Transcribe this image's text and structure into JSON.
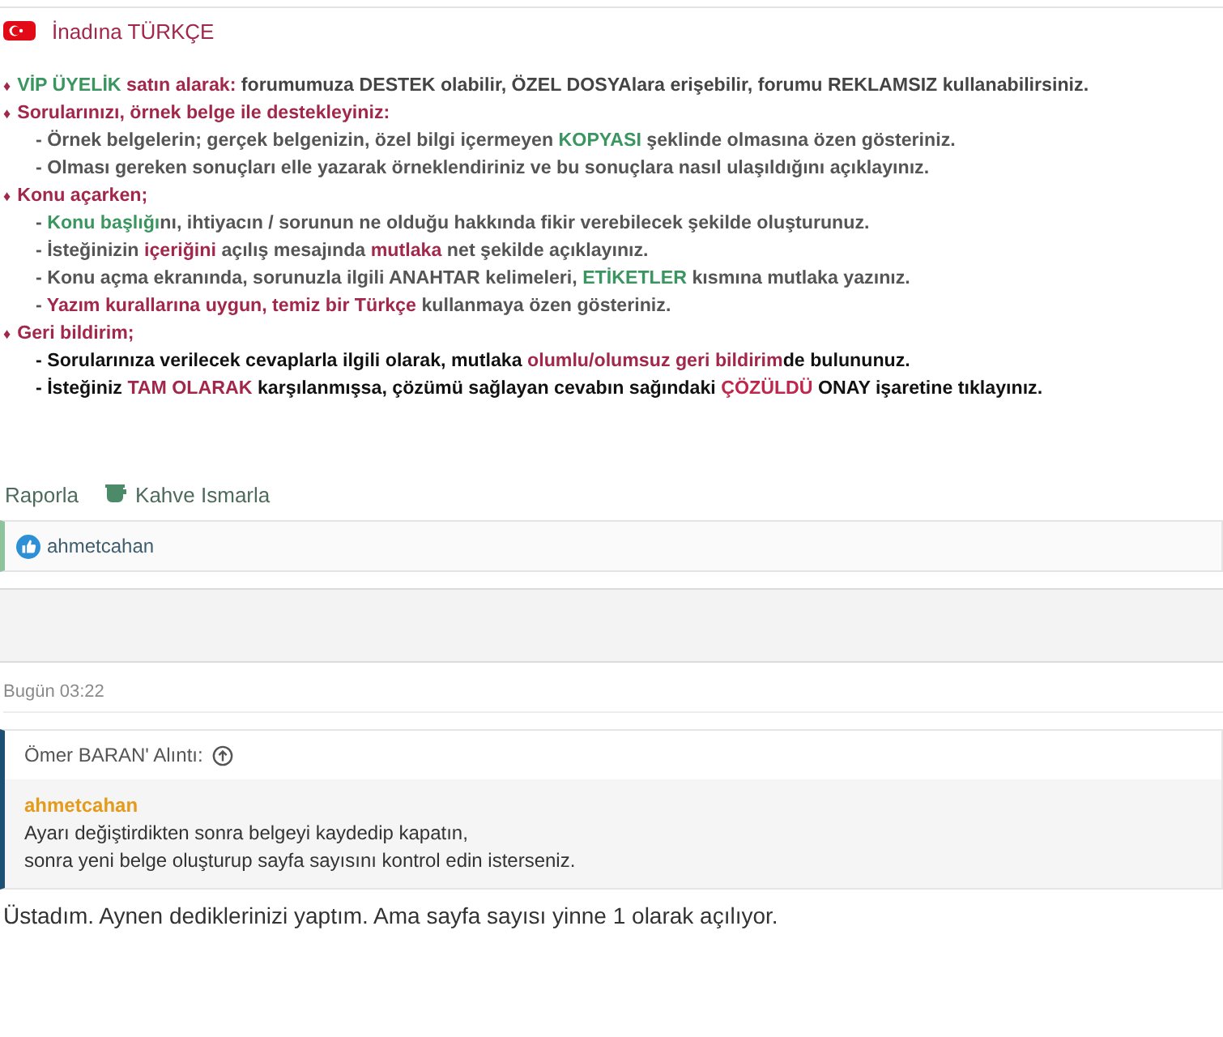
{
  "signature": {
    "title": "İnadına TÜRKÇE",
    "lines": [
      {
        "kind": "bullet",
        "marker": "♦",
        "segments": [
          {
            "text": "VİP ÜYELİK",
            "color": "#3b9560"
          },
          {
            "text": " satın alarak:",
            "color": "#a1284b"
          },
          {
            "text": " forumumuza DESTEK olabilir, ÖZEL DOSYAlara erişebilir, forumu REKLAMSIZ kullanabilirsiniz.",
            "color": "#444444"
          }
        ]
      },
      {
        "kind": "bullet",
        "marker": "♦",
        "segments": [
          {
            "text": "Sorularınızı, örnek belge ile destekleyiniz:",
            "color": "#a1284b"
          }
        ]
      },
      {
        "kind": "sub",
        "segments": [
          {
            "text": "- Örnek belgelerin; gerçek belgenizin, özel bilgi içermeyen ",
            "color": "#555555"
          },
          {
            "text": "KOPYASI",
            "color": "#3b9560"
          },
          {
            "text": " şeklinde olmasına özen gösteriniz.",
            "color": "#555555"
          }
        ]
      },
      {
        "kind": "sub",
        "segments": [
          {
            "text": "- Olması gereken sonuçları elle yazarak örneklendiriniz ve bu sonuçlara nasıl ulaşıldığını açıklayınız.",
            "color": "#555555"
          }
        ]
      },
      {
        "kind": "bullet",
        "marker": "♦",
        "segments": [
          {
            "text": "Konu açarken;",
            "color": "#a1284b"
          }
        ]
      },
      {
        "kind": "sub",
        "segments": [
          {
            "text": "- ",
            "color": "#555555"
          },
          {
            "text": "Konu başlığı",
            "color": "#3b9560"
          },
          {
            "text": "nı, ihtiyacın / sorunun ne olduğu hakkında fikir verebilecek şekilde oluşturunuz.",
            "color": "#555555"
          }
        ]
      },
      {
        "kind": "sub",
        "segments": [
          {
            "text": "- İsteğinizin ",
            "color": "#555555"
          },
          {
            "text": "içeriğini",
            "color": "#a1284b"
          },
          {
            "text": " açılış mesajında ",
            "color": "#555555"
          },
          {
            "text": "mutlaka",
            "color": "#a1284b"
          },
          {
            "text": " net şekilde açıklayınız.",
            "color": "#555555"
          }
        ]
      },
      {
        "kind": "sub",
        "segments": [
          {
            "text": "- Konu açma ekranında, sorunuzla ilgili ANAHTAR kelimeleri, ",
            "color": "#555555"
          },
          {
            "text": "ETİKETLER",
            "color": "#3b9560"
          },
          {
            "text": " kısmına mutlaka yazınız.",
            "color": "#555555"
          }
        ]
      },
      {
        "kind": "sub",
        "segments": [
          {
            "text": "- ",
            "color": "#555555"
          },
          {
            "text": "Yazım kurallarına uygun, temiz bir Türkçe",
            "color": "#a1284b"
          },
          {
            "text": " kullanmaya özen gösteriniz.",
            "color": "#555555"
          }
        ]
      },
      {
        "kind": "bullet",
        "marker": "♦",
        "segments": [
          {
            "text": "Geri bildirim;",
            "color": "#a1284b"
          }
        ]
      },
      {
        "kind": "sub",
        "segments": [
          {
            "text": "- Sorularınıza verilecek cevaplarla ilgili olarak, mutlaka ",
            "color": "#111111"
          },
          {
            "text": "olumlu/olumsuz geri bildirim",
            "color": "#a1284b"
          },
          {
            "text": "de bulununuz.",
            "color": "#111111"
          }
        ]
      },
      {
        "kind": "sub",
        "segments": [
          {
            "text": "- İsteğiniz ",
            "color": "#111111"
          },
          {
            "text": "TAM OLARAK",
            "color": "#a1284b"
          },
          {
            "text": " karşılanmışsa, çözümü sağlayan cevabın sağındaki ",
            "color": "#111111"
          },
          {
            "text": "ÇÖZÜLDÜ",
            "color": "#c0264b"
          },
          {
            "text": " ONAY işaretine tıklayınız.",
            "color": "#111111"
          }
        ]
      }
    ]
  },
  "actions": [
    {
      "kind": "report",
      "label": "Raporla"
    },
    {
      "kind": "coffee",
      "label": "Kahve Ismarla"
    }
  ],
  "reactions": {
    "user": "ahmetcahan"
  },
  "post": {
    "time": "Bugün 03:22",
    "quote": {
      "header": "Ömer BARAN' Alıntı:",
      "author": "ahmetcahan",
      "lines": [
        "Ayarı değiştirdikten sonra belgeyi kaydedip kapatın,",
        "sonra yeni belge oluşturup sayfa sayısını kontrol edin isterseniz."
      ]
    },
    "body": "Üstadım. Aynen dediklerinizi yaptım. Ama sayfa sayısı yinne 1 olarak açılıyor."
  }
}
